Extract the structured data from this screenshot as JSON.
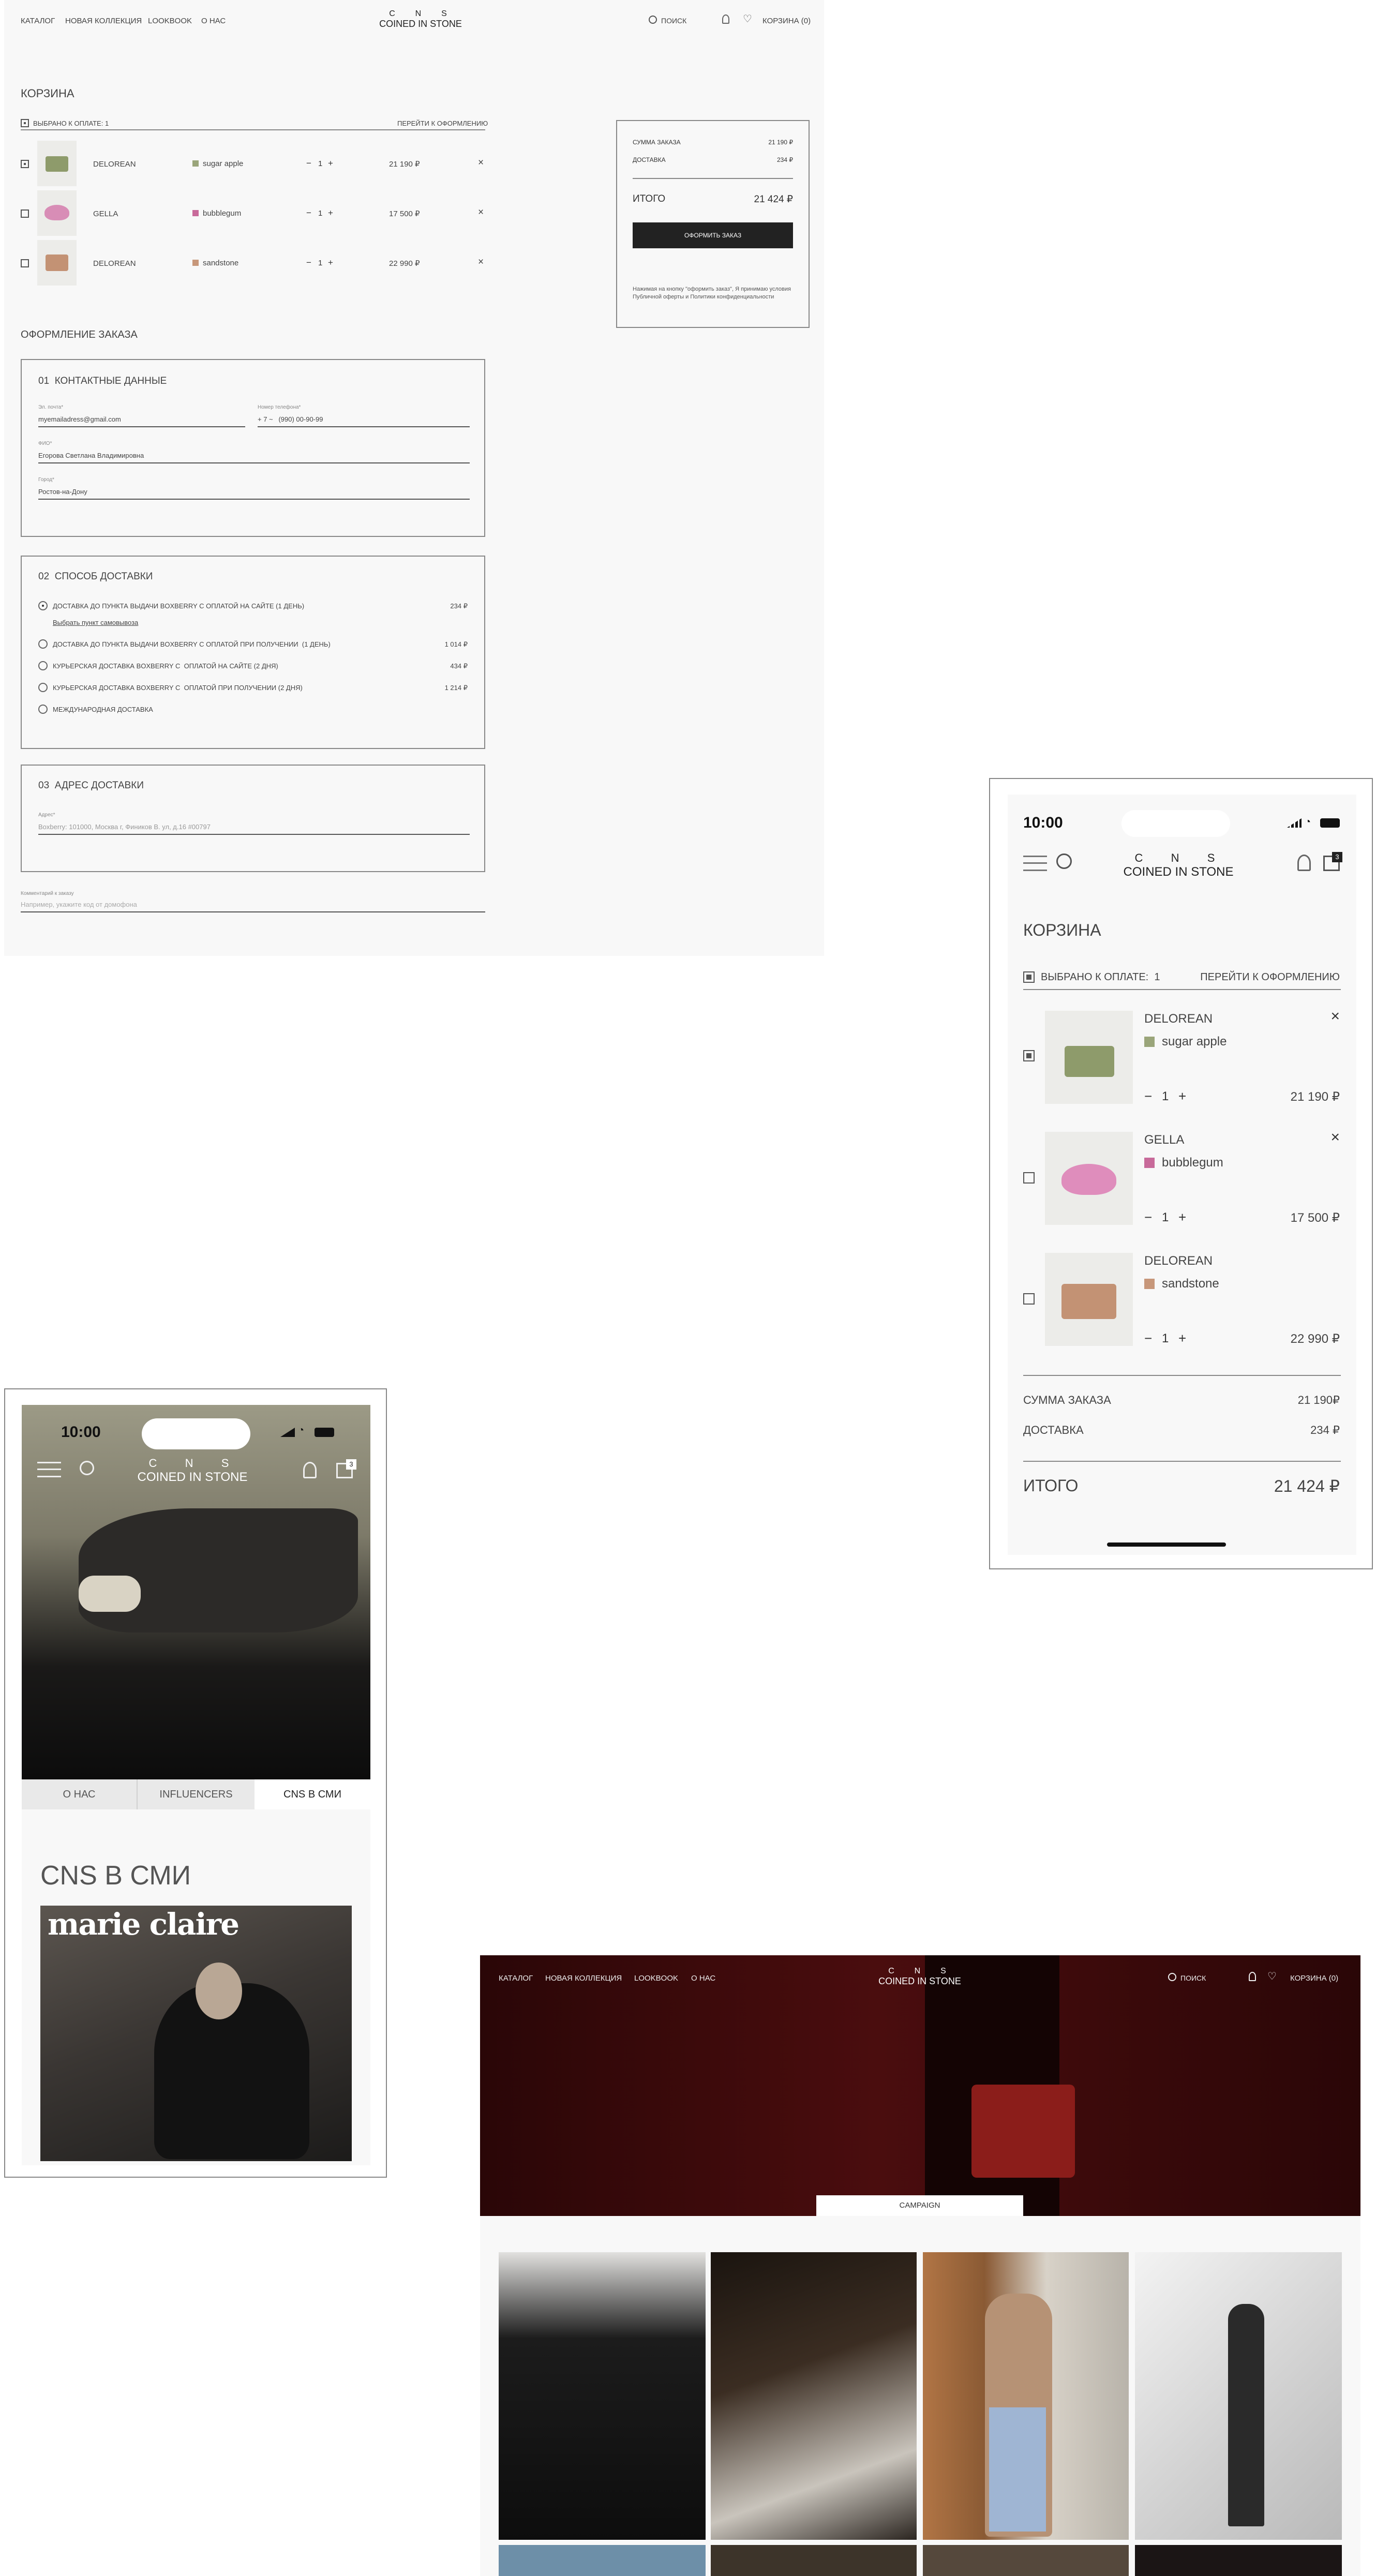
{
  "desktop_cart": {
    "nav": {
      "catalog": "КАТАЛОГ",
      "new_collection": "НОВАЯ КОЛЛЕКЦИЯ",
      "lookbook": "LOOKBOOK",
      "about": "О НАС"
    },
    "logo": {
      "letters": "C  N  S",
      "name": "COINED IN STONE"
    },
    "search": "ПОИСК",
    "cart_link": "КОРЗИНА (0)",
    "cart_title": "КОРЗИНА",
    "selected": "ВЫБРАНО К ОПЛАТЕ: 1",
    "go_checkout": "ПЕРЕЙТИ К ОФОРМЛЕНИЮ",
    "items": [
      {
        "name": "DELOREAN",
        "color": "sugar apple",
        "swatch": "#9aa57a",
        "qty": "1",
        "price": "21 190 ₽",
        "checked": true
      },
      {
        "name": "GELLA",
        "color": "bubblegum",
        "swatch": "#c86a9a",
        "qty": "1",
        "price": "17 500 ₽",
        "checked": false
      },
      {
        "name": "DELOREAN",
        "color": "sandstone",
        "swatch": "#c7977a",
        "qty": "1",
        "price": "22 990 ₽",
        "checked": false
      }
    ],
    "summary": {
      "order_sum_label": "СУММА ЗАКАЗА",
      "order_sum": "21 190 ₽",
      "delivery_label": "ДОСТАВКА",
      "delivery": "234 ₽",
      "total_label": "ИТОГО",
      "total": "21 424 ₽",
      "button": "ОФОРМИТЬ ЗАКАЗ",
      "note": "Нажимая на кнопку \"оформить заказ\", Я принимаю условия Публичной оферты и Политики конфиденциальности"
    },
    "checkout_title": "ОФОРМЛЕНИЕ ЗАКАЗА",
    "contact": {
      "title": "01  КОНТАКТНЫЕ ДАННЫЕ",
      "email_label": "Эл. почта*",
      "email": "myemailadress@gmail.com",
      "phone_label": "Номер телефона*",
      "phone": "+ 7 ~   (990) 00-90-99",
      "fio_label": "ФИО*",
      "fio": "Егорова Светлана Владимировна",
      "city_label": "Город*",
      "city": "Ростов-на-Дону"
    },
    "delivery": {
      "title": "02  СПОСОБ ДОСТАВКИ",
      "options": [
        {
          "label": "ДОСТАВКА ДО ПУНКТА ВЫДАЧИ BOXBERRY С ОПЛАТОЙ НА САЙТЕ (1 ДЕНЬ)",
          "price": "234 ₽",
          "selected": true
        },
        {
          "label": "ДОСТАВКА ДО ПУНКТА ВЫДАЧИ BOXBERRY С ОПЛАТОЙ ПРИ ПОЛУЧЕНИИ  (1 ДЕНЬ)",
          "price": "1 014 ₽",
          "selected": false
        },
        {
          "label": "КУРЬЕРСКАЯ ДОСТАВКА BOXBERRY С  ОПЛАТОЙ НА САЙТЕ (2 ДНЯ)",
          "price": "434 ₽",
          "selected": false
        },
        {
          "label": "КУРЬЕРСКАЯ ДОСТАВКА BOXBERRY С  ОПЛАТОЙ ПРИ ПОЛУЧЕНИИ (2 ДНЯ)",
          "price": "1 214 ₽",
          "selected": false
        },
        {
          "label": "МЕЖДУНАРОДНАЯ ДОСТАВКА",
          "price": "",
          "selected": false
        }
      ],
      "pickup_link": "Выбрать пункт самовывоза"
    },
    "address": {
      "title": "03  АДРЕС ДОСТАВКИ",
      "label": "Адрес*",
      "value": "Boxberry: 101000, Москва г, Фиников В. ул, д.16 #00797"
    },
    "comment": {
      "label": "Комментарий к заказу",
      "placeholder": "Например, укажите код от домофона"
    }
  },
  "mobile_cart": {
    "time": "10:00",
    "logo": {
      "letters": "C  N  S",
      "name": "COINED IN STONE"
    },
    "cart_badge": "3",
    "title": "КОРЗИНА",
    "selected": "ВЫБРАНО К ОПЛАТЕ:  1",
    "go_checkout": "ПЕРЕЙТИ К ОФОРМЛЕНИЮ",
    "items": [
      {
        "name": "DELOREAN",
        "color": "sugar apple",
        "qty": "1",
        "price": "21 190 ₽",
        "close": "×"
      },
      {
        "name": "GELLA",
        "color": "bubblegum",
        "qty": "1",
        "price": "17 500 ₽",
        "close": "×"
      },
      {
        "name": "DELOREAN",
        "color": "sandstone",
        "qty": "1",
        "price": "22 990 ₽"
      }
    ],
    "order_sum_label": "СУММА ЗАКАЗА",
    "order_sum": "21 190₽",
    "delivery_label": "ДОСТАВКА",
    "delivery": "234 ₽",
    "total_label": "ИТОГО",
    "total": "21 424 ₽"
  },
  "mobile_about": {
    "time": "10:00",
    "logo": {
      "letters": "C  N  S",
      "name": "COINED IN STONE"
    },
    "cart_badge": "3",
    "tabs": [
      "О НАС",
      "INFLUENCERS",
      "CNS В СМИ"
    ],
    "heading": "CNS В СМИ",
    "magazine": "marie claire"
  },
  "desktop_lookbook": {
    "nav": {
      "catalog": "КАТАЛОГ",
      "new_collection": "НОВАЯ КОЛЛЕКЦИЯ",
      "lookbook": "LOOKBOOK",
      "about": "О НАС"
    },
    "logo": {
      "letters": "C  N  S",
      "name": "COINED IN STONE"
    },
    "search": "ПОИСК",
    "cart_link": "КОРЗИНА (0)",
    "tab": "CAMPAIGN"
  },
  "common": {
    "minus": "−",
    "plus": "+",
    "remove": "×"
  }
}
